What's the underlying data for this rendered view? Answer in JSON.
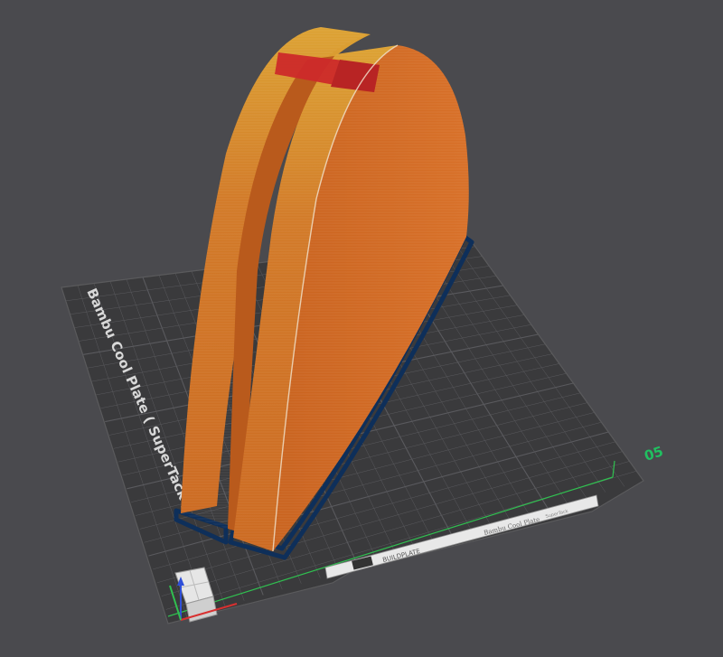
{
  "plate": {
    "name": "Bambu Cool Plate ( SuperTack )",
    "number_label": "05",
    "brand_label": "BUILDPLATE",
    "sticker_label": "Bambu Cool Plate",
    "sticker_sub": "SuperTack"
  },
  "colors": {
    "background": "#4a4a4e",
    "plate_surface": "#3a3a3c",
    "grid": "#5c5c5e",
    "model_primary": "#d46b24",
    "model_highlight": "#e6b93a",
    "model_color_change": "#cc2a2a",
    "brim": "#0e2f5a",
    "axis_x": "#d83030",
    "axis_y": "#30c050",
    "axis_z": "#2f4fd8",
    "plate_number": "#20c060"
  },
  "icons": {
    "view_cube": "view-cube-icon",
    "axes": "axes-gizmo-icon"
  }
}
